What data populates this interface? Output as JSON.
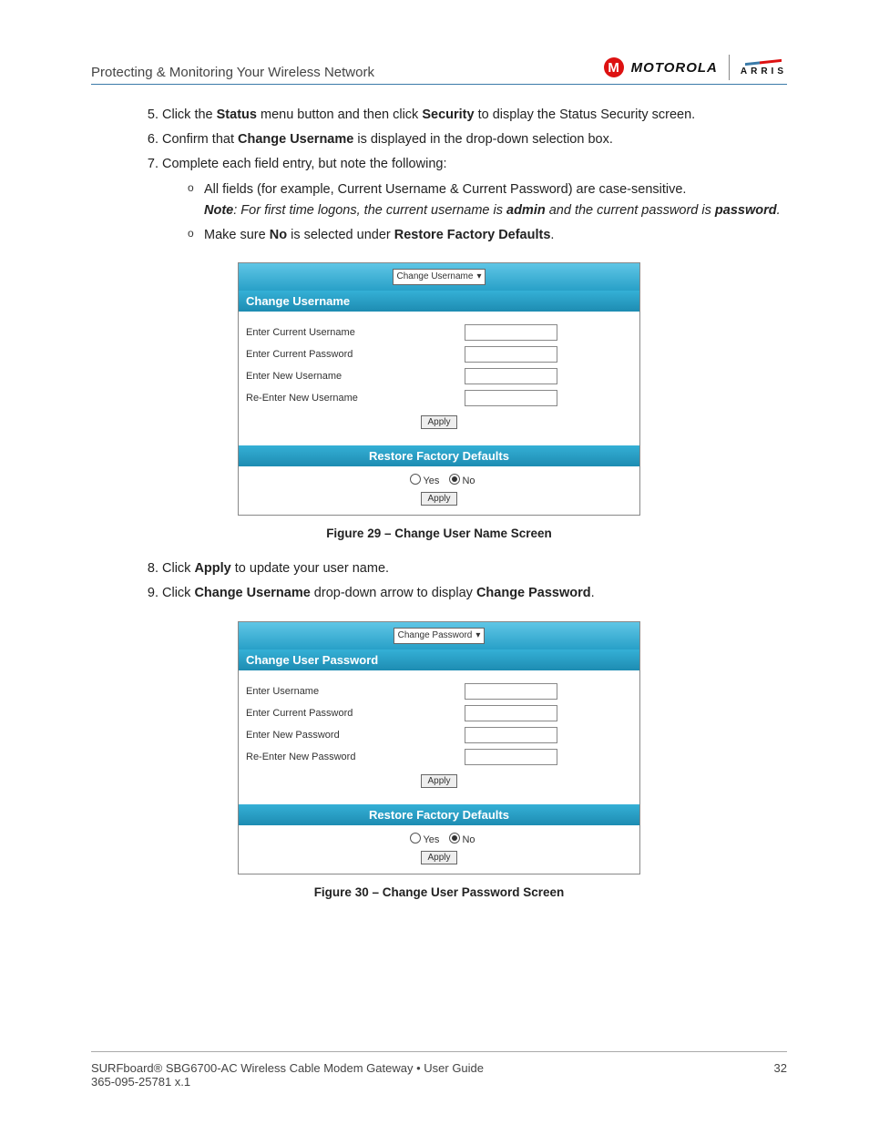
{
  "header": {
    "title": "Protecting & Monitoring Your Wireless Network",
    "motorola": "MOTOROLA",
    "arris": "ARRIS"
  },
  "steps_a": {
    "s5_pre": "Click the ",
    "s5_b1": "Status",
    "s5_mid": " menu button and then click ",
    "s5_b2": "Security",
    "s5_post": " to display the Status Security screen.",
    "s6_pre": "Confirm that ",
    "s6_b": "Change Username",
    "s6_post": " is displayed in the drop-down selection box.",
    "s7": "Complete each field entry, but note the following:",
    "s7_sub1": "All fields (for example, Current Username & Current Password) are case-sensitive.",
    "s7_note_pre": "Note",
    "s7_note_mid1": ": For first time logons, the current username is ",
    "s7_note_b1": "admin",
    "s7_note_mid2": " and the current password is ",
    "s7_note_b2": "password",
    "s7_note_post": ".",
    "s7_sub2_pre": "Make sure ",
    "s7_sub2_b1": "No",
    "s7_sub2_mid": " is selected under ",
    "s7_sub2_b2": "Restore Factory Defaults",
    "s7_sub2_post": "."
  },
  "ui1": {
    "dropdown": "Change Username",
    "title": "Change Username",
    "fields": [
      "Enter Current Username",
      "Enter Current Password",
      "Enter New Username",
      "Re-Enter New Username"
    ],
    "apply": "Apply",
    "rfd_title": "Restore Factory Defaults",
    "yes": "Yes",
    "no": "No"
  },
  "caption1": "Figure 29 – Change User Name Screen",
  "steps_b": {
    "s8_pre": "Click ",
    "s8_b": "Apply",
    "s8_post": " to update your user name.",
    "s9_pre": "Click ",
    "s9_b1": "Change Username",
    "s9_mid": " drop-down arrow to display ",
    "s9_b2": "Change Password",
    "s9_post": "."
  },
  "ui2": {
    "dropdown": "Change Password",
    "title": "Change User Password",
    "fields": [
      "Enter Username",
      "Enter Current Password",
      "Enter New Password",
      "Re-Enter New Password"
    ],
    "apply": "Apply",
    "rfd_title": "Restore Factory Defaults",
    "yes": "Yes",
    "no": "No"
  },
  "caption2": "Figure 30 – Change User Password Screen",
  "footer": {
    "left": "SURFboard® SBG6700-AC Wireless Cable Modem Gateway • User Guide",
    "page": "32",
    "docnum": "365-095-25781 x.1"
  }
}
